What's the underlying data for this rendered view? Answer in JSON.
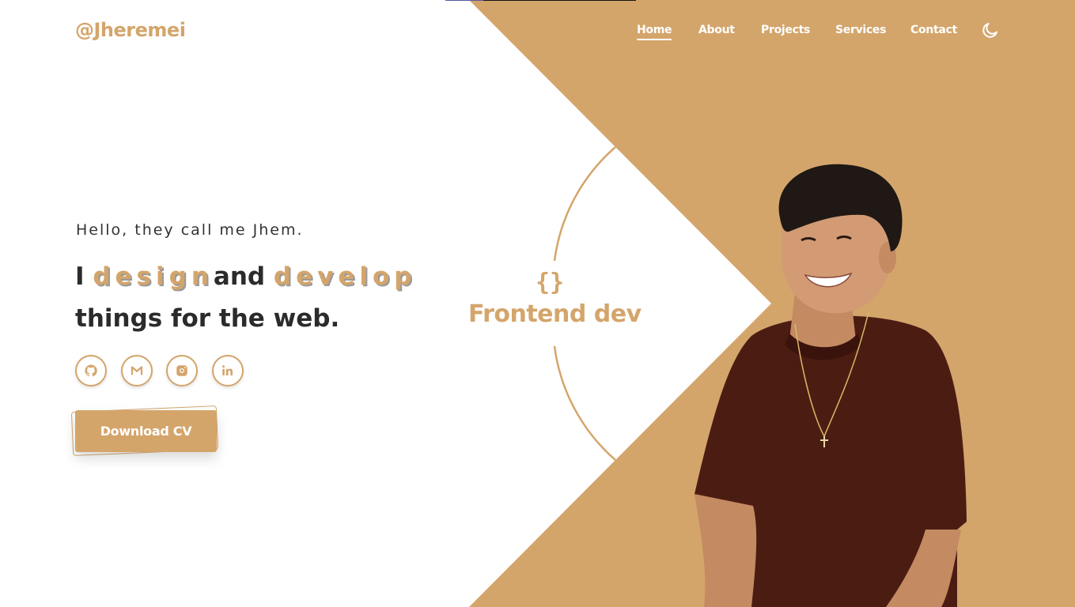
{
  "logo": "@Jheremei",
  "nav": {
    "items": [
      "Home",
      "About",
      "Projects",
      "Services",
      "Contact"
    ],
    "active": "Home",
    "theme_icon": "moon-icon"
  },
  "hero": {
    "greeting": "Hello, they call me Jhem.",
    "line1_prefix": "I",
    "line1_word1": "design",
    "line1_middle": "and",
    "line1_word2": "develop",
    "line2": "things for the web.",
    "socials": [
      {
        "name": "github",
        "icon": "github-icon"
      },
      {
        "name": "gmail",
        "icon": "gmail-icon"
      },
      {
        "name": "instagram",
        "icon": "instagram-icon"
      },
      {
        "name": "linkedin",
        "icon": "linkedin-icon"
      }
    ],
    "cta": "Download CV"
  },
  "badge": {
    "braces": "{}",
    "role": "Frontend dev"
  },
  "colors": {
    "accent": "#d4a56b",
    "text": "#2b2b2b",
    "background": "#ffffff",
    "shirt": "#4b1d12"
  }
}
